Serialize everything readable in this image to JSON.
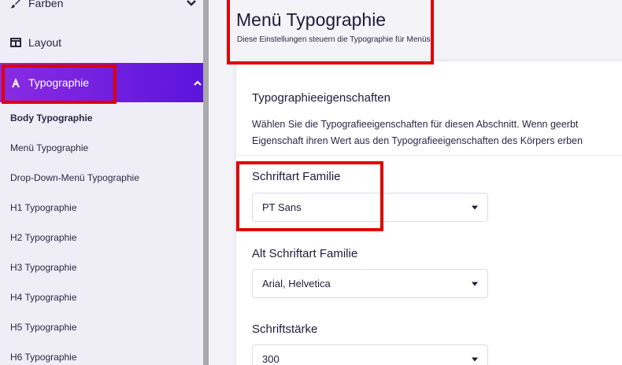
{
  "sidebar": {
    "items": [
      {
        "label": "Farben",
        "icon": "brush-icon"
      },
      {
        "label": "Layout",
        "icon": "layout-icon"
      },
      {
        "label": "Typographie",
        "icon": "font-icon"
      }
    ],
    "sub_items": [
      "Body Typographie",
      "Menü Typographie",
      "Drop-Down-Menü Typographie",
      "H1 Typographie",
      "H2 Typographie",
      "H3 Typographie",
      "H4 Typographie",
      "H5 Typographie",
      "H6 Typographie"
    ],
    "active_color_start": "#8a2be2",
    "active_color_end": "#5a14dc"
  },
  "header": {
    "title": "Menü Typographie",
    "subtitle": "Diese Einstellungen steuern die Typographie für Menüs."
  },
  "section": {
    "title": "Typographieeigenschaften",
    "desc_line1": "Wählen Sie die Typografieeigenschaften für diesen Abschnitt. Wenn geerbt",
    "desc_line2": "Eigenschaft ihren Wert aus den Typografieeigenschaften des Körpers erben"
  },
  "fields": {
    "font_family": {
      "label": "Schriftart Familie",
      "value": "PT Sans"
    },
    "alt_font_family": {
      "label": "Alt Schriftart Familie",
      "value": "Arial, Helvetica"
    },
    "font_weight": {
      "label": "Schriftstärke",
      "value": "300"
    }
  },
  "highlight_color": "#e00000"
}
